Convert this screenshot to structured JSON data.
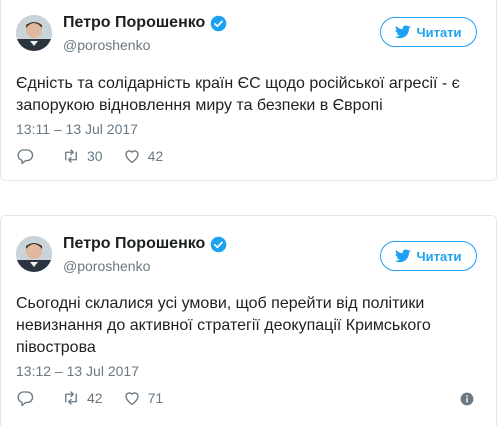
{
  "tweets": [
    {
      "author": {
        "name": "Петро Порошенко",
        "handle": "@poroshenko",
        "verified": true
      },
      "follow_label": "Читати",
      "text": "Єдність та солідарність країн ЄС щодо російської агресії - є запорукою відновлення миру та безпеки в Європі",
      "timestamp": "13:11 – 13 Jul 2017",
      "retweets": "30",
      "likes": "42"
    },
    {
      "author": {
        "name": "Петро Порошенко",
        "handle": "@poroshenko",
        "verified": true
      },
      "follow_label": "Читати",
      "text": "Сьогодні склалися усі умови, щоб перейти від політики невизнання до активної стратегії деокупації Кримського півострова",
      "timestamp": "13:12 – 13 Jul 2017",
      "retweets": "42",
      "likes": "71"
    }
  ],
  "icons": {
    "verified": "verified-badge-icon",
    "follow": "twitter-bird-icon",
    "reply": "reply-icon",
    "retweet": "retweet-icon",
    "like": "heart-icon",
    "info": "info-icon"
  },
  "colors": {
    "accent": "#1da1f2",
    "text": "#1c2022",
    "muted": "#697882",
    "border": "#e1e8ed"
  }
}
